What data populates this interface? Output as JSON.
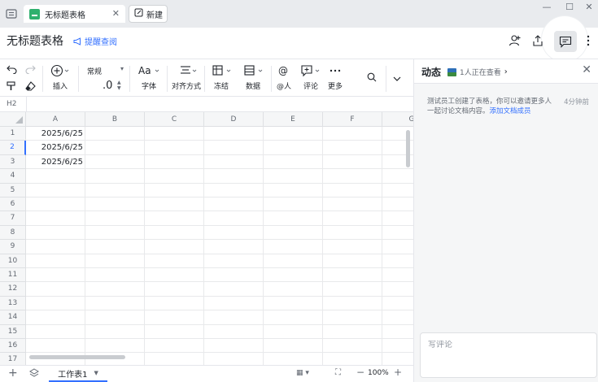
{
  "tabs": {
    "active_title": "无标题表格",
    "new_label": "新建"
  },
  "header": {
    "doc_title": "无标题表格",
    "remind_label": "提醒查阅"
  },
  "toolbar": {
    "insert_label": "插入",
    "number_format": "常规",
    "decimal_value": ".0",
    "font_label": "字体",
    "align_label": "对齐方式",
    "freeze_label": "冻结",
    "data_label": "数据",
    "mention_label": "@人",
    "comment_label": "评论",
    "more_label": "更多"
  },
  "formula_bar": {
    "cell_ref": "H2"
  },
  "grid": {
    "columns": [
      "A",
      "B",
      "C",
      "D",
      "E",
      "F",
      "G"
    ],
    "rows": [
      "1",
      "2",
      "3",
      "4",
      "5",
      "6",
      "7",
      "8",
      "9",
      "10",
      "11",
      "12",
      "13",
      "14",
      "15",
      "16",
      "17"
    ],
    "selected_row": "2",
    "cells": {
      "A1": "2025/6/25",
      "A2": "2025/6/25",
      "A3": "2025/6/25"
    }
  },
  "bottom": {
    "sheet_name": "工作表1",
    "zoom": "100%"
  },
  "panel": {
    "title": "动态",
    "viewer_text": "1人正在查看",
    "activity_text": "测试员工创建了表格，你可以邀请更多人一起讨论文档内容。",
    "activity_link": "添加文档成员",
    "activity_time": "4分钟前",
    "comment_placeholder": "写评论"
  },
  "colors": {
    "accent": "#3370ff",
    "sheet_icon": "#2fb06e"
  }
}
